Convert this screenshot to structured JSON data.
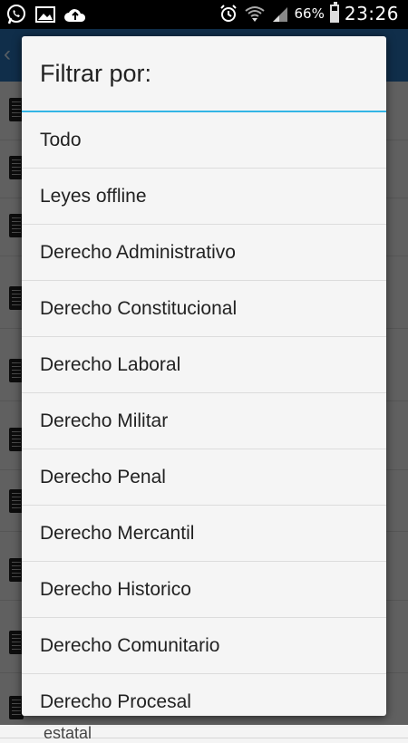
{
  "status_bar": {
    "battery_text": "66%",
    "battery_level": 0.66,
    "time": "23:26",
    "left_icons": [
      "whatsapp-icon",
      "image-icon",
      "cloud-upload-icon"
    ],
    "right_icons": [
      "alarm-icon",
      "wifi-icon",
      "signal-icon",
      "battery-icon"
    ]
  },
  "background": {
    "app_bar_color": "#2a73b8",
    "partial_text": "estatal"
  },
  "dialog": {
    "title": "Filtrar por:",
    "divider_color": "#33b5e5",
    "options": [
      "Todo",
      "Leyes offline",
      "Derecho Administrativo",
      "Derecho Constitucional",
      "Derecho Laboral",
      "Derecho Militar",
      "Derecho Penal",
      "Derecho Mercantil",
      "Derecho Historico",
      "Derecho Comunitario",
      "Derecho Procesal"
    ]
  }
}
